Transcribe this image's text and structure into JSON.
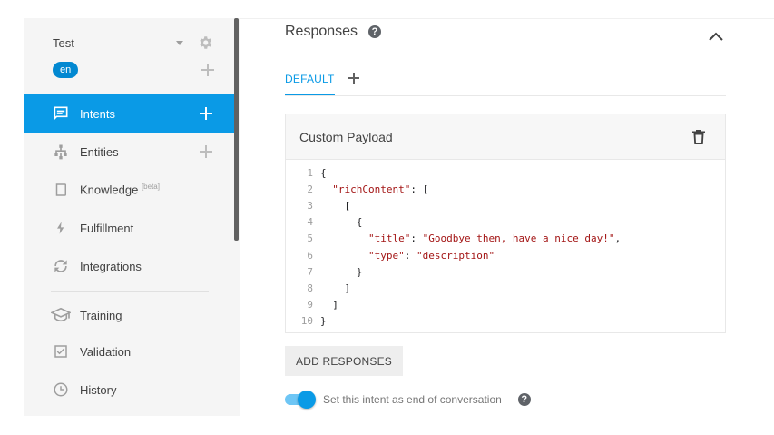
{
  "agent": {
    "name": "Test",
    "language": "en"
  },
  "sidebar": {
    "items": [
      {
        "label": "Intents"
      },
      {
        "label": "Entities"
      },
      {
        "label": "Knowledge",
        "badge": "[beta]"
      },
      {
        "label": "Fulfillment"
      },
      {
        "label": "Integrations"
      },
      {
        "label": "Training"
      },
      {
        "label": "Validation"
      },
      {
        "label": "History"
      }
    ]
  },
  "responses": {
    "title": "Responses",
    "tabs": [
      {
        "label": "DEFAULT"
      }
    ],
    "card_title": "Custom Payload",
    "code_lines": [
      {
        "n": "1",
        "t": "{"
      },
      {
        "n": "2",
        "t": "  \"richContent\": ["
      },
      {
        "n": "3",
        "t": "    ["
      },
      {
        "n": "4",
        "t": "      {"
      },
      {
        "n": "5",
        "t": "        \"title\": \"Goodbye then, have a nice day!\","
      },
      {
        "n": "6",
        "t": "        \"type\": \"description\""
      },
      {
        "n": "7",
        "t": "      }"
      },
      {
        "n": "8",
        "t": "    ]"
      },
      {
        "n": "9",
        "t": "  ]"
      },
      {
        "n": "10",
        "t": "}"
      }
    ],
    "add_button": "ADD RESPONSES",
    "end_toggle_label": "Set this intent as end of conversation",
    "end_toggle_on": true
  },
  "colors": {
    "accent": "#0a9ae6",
    "string": "#a31515"
  }
}
